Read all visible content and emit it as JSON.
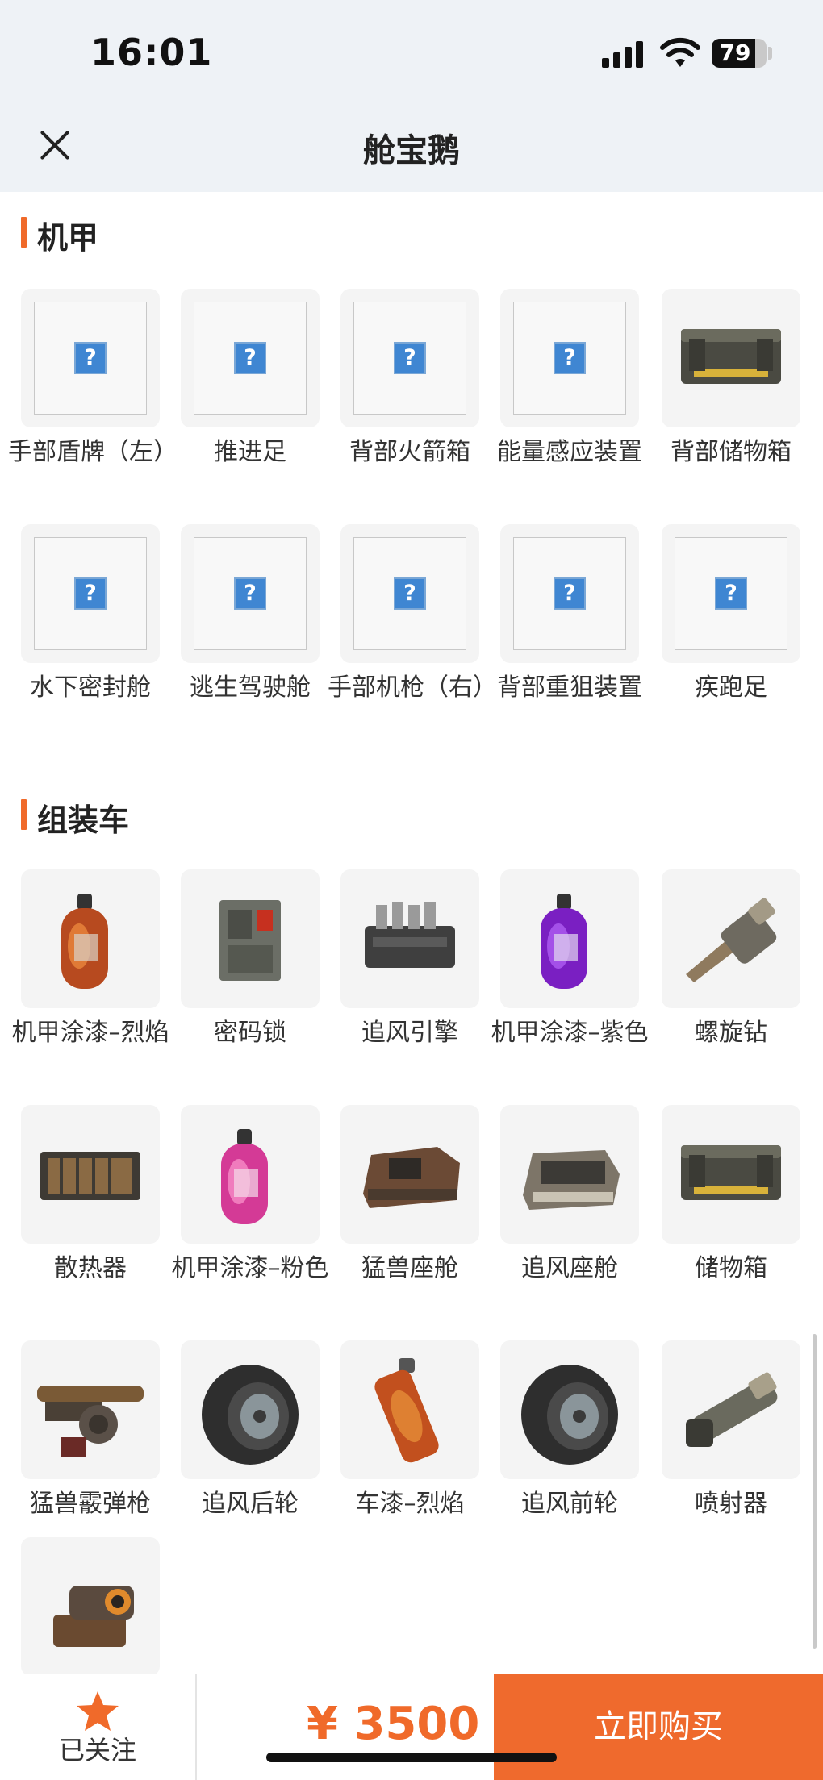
{
  "status_bar": {
    "time": "16:01",
    "battery": "79",
    "battery_level": 0.79
  },
  "nav": {
    "title": "舱宝鹅",
    "close_icon": "close-icon"
  },
  "sections": [
    {
      "title": "机甲",
      "items": [
        {
          "name": "手部盾牌（左）",
          "image": "placeholder"
        },
        {
          "name": "推进足",
          "image": "placeholder"
        },
        {
          "name": "背部火箭箱",
          "image": "placeholder"
        },
        {
          "name": "能量感应装置",
          "image": "placeholder"
        },
        {
          "name": "背部储物箱",
          "image": "storage-box"
        },
        {
          "name": "水下密封舱",
          "image": "placeholder"
        },
        {
          "name": "逃生驾驶舱",
          "image": "placeholder"
        },
        {
          "name": "手部机枪（右）",
          "image": "placeholder"
        },
        {
          "name": "背部重狙装置",
          "image": "placeholder"
        },
        {
          "name": "疾跑足",
          "image": "placeholder"
        }
      ]
    },
    {
      "title": "组装车",
      "items": [
        {
          "name": "机甲涂漆–烈焰",
          "image": "paint-bottle-flame"
        },
        {
          "name": "密码锁",
          "image": "code-lock"
        },
        {
          "name": "追风引擎",
          "image": "engine"
        },
        {
          "name": "机甲涂漆–紫色",
          "image": "paint-bottle-purple"
        },
        {
          "name": "螺旋钻",
          "image": "drill"
        },
        {
          "name": "散热器",
          "image": "radiator"
        },
        {
          "name": "机甲涂漆–粉色",
          "image": "paint-bottle-pink"
        },
        {
          "name": "猛兽座舱",
          "image": "beast-cockpit"
        },
        {
          "name": "追风座舱",
          "image": "wind-cockpit"
        },
        {
          "name": "储物箱",
          "image": "storage-box"
        },
        {
          "name": "猛兽霰弹枪",
          "image": "shotgun"
        },
        {
          "name": "追风后轮",
          "image": "wheel"
        },
        {
          "name": "车漆–烈焰",
          "image": "spray-can"
        },
        {
          "name": "追风前轮",
          "image": "wheel"
        },
        {
          "name": "喷射器",
          "image": "injector"
        },
        {
          "name": "",
          "image": "turret"
        }
      ]
    }
  ],
  "bottom_bar": {
    "follow_label": "已关注",
    "follow_icon": "star-icon",
    "price": "¥ 3500",
    "buy_label": "立即购买"
  },
  "colors": {
    "accent": "#ef6a2d",
    "nav_bg": "#eef2f6",
    "tile_bg": "#f4f4f4"
  }
}
